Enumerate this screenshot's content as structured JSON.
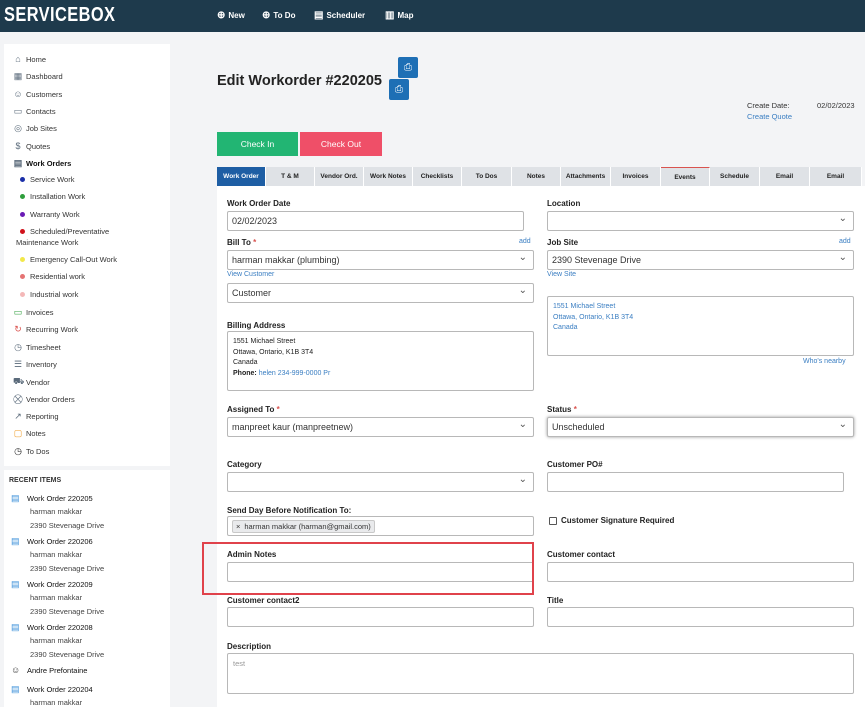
{
  "app": {
    "logo": "SERVICEBOX"
  },
  "topnav": [
    {
      "icon": "plus-circle-icon",
      "glyph": "⊕",
      "label": "New"
    },
    {
      "icon": "plus-circle-icon",
      "glyph": "⊕",
      "label": "To Do"
    },
    {
      "icon": "calendar-icon",
      "glyph": "▤",
      "label": "Scheduler"
    },
    {
      "icon": "map-icon",
      "glyph": "▥",
      "label": "Map"
    }
  ],
  "sidebar": {
    "items": [
      {
        "label": "Home",
        "glyph": "⌂"
      },
      {
        "label": "Dashboard",
        "glyph": "▦"
      },
      {
        "label": "Customers",
        "glyph": "☺"
      },
      {
        "label": "Contacts",
        "glyph": "▭"
      },
      {
        "label": "Job Sites",
        "glyph": "◎"
      },
      {
        "label": "Quotes",
        "glyph": "$"
      },
      {
        "label": "Work Orders",
        "glyph": "▤"
      },
      {
        "label": "Invoices",
        "glyph": "▭"
      },
      {
        "label": "Recurring Work",
        "glyph": "↻"
      },
      {
        "label": "Timesheet",
        "glyph": "◷"
      },
      {
        "label": "Inventory",
        "glyph": "☰"
      },
      {
        "label": "Vendor",
        "glyph": "⛟"
      },
      {
        "label": "Vendor Orders",
        "glyph": "⛒"
      },
      {
        "label": "Reporting",
        "glyph": "↗"
      },
      {
        "label": "Notes",
        "glyph": "▢"
      },
      {
        "label": "To Dos",
        "glyph": "◷"
      }
    ],
    "work_order_types": [
      {
        "label": "Service Work",
        "color": "#1b2fa8"
      },
      {
        "label": "Installation Work",
        "color": "#2e9e3c"
      },
      {
        "label": "Warranty Work",
        "color": "#6a1bb5"
      },
      {
        "label": "Scheduled/Preventative",
        "label2": "Maintenance Work",
        "color": "#d0121b"
      },
      {
        "label": "Emergency Call-Out Work",
        "color": "#f2e84a"
      },
      {
        "label": "Residential work",
        "color": "#e57373"
      },
      {
        "label": "Industrial work",
        "color": "#f4b8b8"
      }
    ]
  },
  "recent": {
    "title": "RECENT ITEMS",
    "items": [
      {
        "label": "Work Order 220205",
        "sub1": "harman makkar",
        "sub2": "2390 Stevenage Drive"
      },
      {
        "label": "Work Order 220206",
        "sub1": "harman makkar",
        "sub2": "2390 Stevenage Drive"
      },
      {
        "label": "Work Order 220209",
        "sub1": "harman makkar",
        "sub2": "2390 Stevenage Drive"
      },
      {
        "label": "Work Order 220208",
        "sub1": "harman makkar",
        "sub2": "2390 Stevenage Drive"
      },
      {
        "label": "Andre Prefontaine"
      },
      {
        "label": "Work Order 220204",
        "sub1": "harman makkar"
      }
    ]
  },
  "header": {
    "title": "Edit Workorder #220205",
    "create_date_label": "Create Date:",
    "create_date": "02/02/2023",
    "create_quote": "Create Quote"
  },
  "actions": {
    "check_in": "Check In",
    "check_out": "Check Out"
  },
  "tabs": [
    "Work Order",
    "T & M",
    "Vendor Ord.",
    "Work Notes",
    "Checklists",
    "To Dos",
    "Notes",
    "Attachments",
    "Invoices",
    "Events",
    "Schedule",
    "Email",
    "Email"
  ],
  "form": {
    "work_order_date_label": "Work Order Date",
    "work_order_date": "02/02/2023",
    "location_label": "Location",
    "location": "",
    "bill_to_label": "Bill To",
    "bill_to": "harman makkar (plumbing)",
    "add": "add",
    "view_customer": "View Customer",
    "customer_type": "Customer",
    "job_site_label": "Job Site",
    "job_site": "2390 Stevenage Drive",
    "view_site": "View Site",
    "site_address": [
      "1551 Michael Street",
      "Ottawa, Ontario, K1B 3T4",
      "Canada"
    ],
    "whos_nearby": "Who's nearby",
    "billing_address_label": "Billing Address",
    "billing_address": [
      "1551 Michael Street",
      "Ottawa, Ontario, K1B 3T4",
      "Canada"
    ],
    "phone_label": "Phone:",
    "phone_value": "helen 234-999-0000 Pr",
    "assigned_to_label": "Assigned To",
    "assigned_to": "manpreet kaur (manpreetnew)",
    "status_label": "Status",
    "status": "Unscheduled",
    "category_label": "Category",
    "category": "",
    "customer_po_label": "Customer PO#",
    "customer_po": "",
    "notification_label": "Send Day Before Notification To:",
    "notification_chip": "harman makkar (harman@gmail.com)",
    "signature_label": "Customer Signature Required",
    "admin_notes_label": "Admin Notes",
    "admin_notes": "",
    "customer_contact_label": "Customer contact",
    "customer_contact": "",
    "customer_contact2_label": "Customer contact2",
    "customer_contact2": "",
    "title_label": "Title",
    "title": "",
    "description_label": "Description",
    "description": "test"
  }
}
